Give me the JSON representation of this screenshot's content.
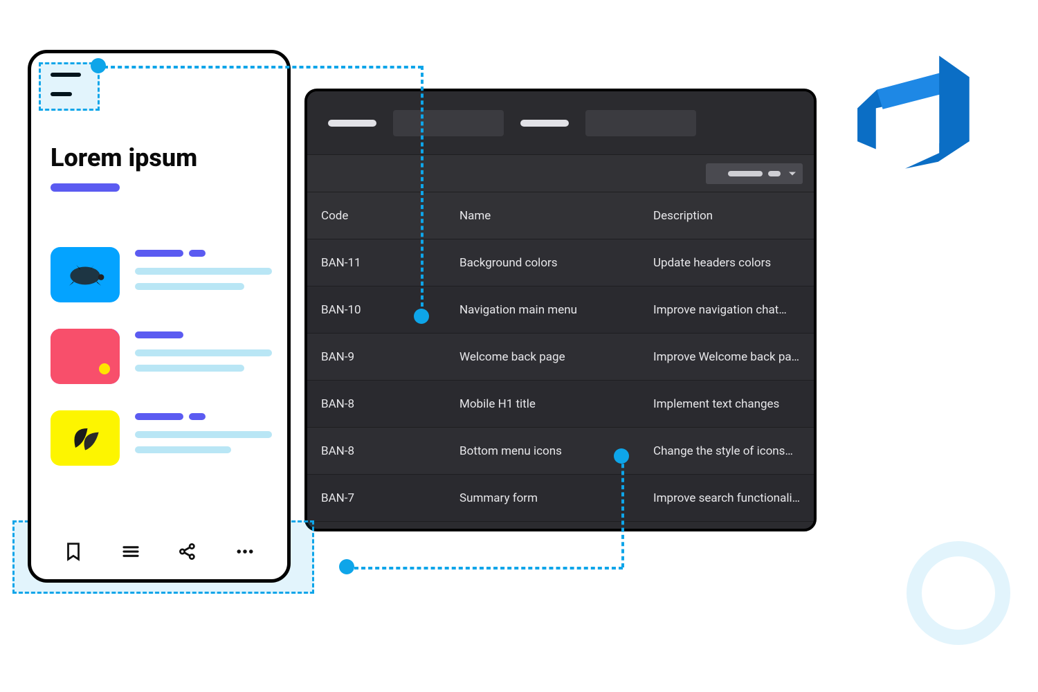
{
  "phone": {
    "title": "Lorem ipsum",
    "nav_icons": [
      "bookmark-icon",
      "list-icon",
      "share-icon",
      "more-icon"
    ]
  },
  "table": {
    "columns": [
      "Code",
      "Name",
      "Description"
    ],
    "rows": [
      {
        "code": "BAN-11",
        "name": "Background colors",
        "desc": "Update headers colors"
      },
      {
        "code": "BAN-10",
        "name": "Navigation main menu",
        "desc": "Improve navigation chat…"
      },
      {
        "code": "BAN-9",
        "name": "Welcome back page",
        "desc": "Improve Welcome back page"
      },
      {
        "code": "BAN-8",
        "name": "Mobile H1 title",
        "desc": "Implement  text changes"
      },
      {
        "code": "BAN-8",
        "name": "Bottom menu icons",
        "desc": "Change the style of icons…"
      },
      {
        "code": "BAN-7",
        "name": "Summary form",
        "desc": "Improve search functionality"
      }
    ]
  },
  "colors": {
    "accent": "#0ea5e9",
    "purple": "#5b5bf1"
  }
}
